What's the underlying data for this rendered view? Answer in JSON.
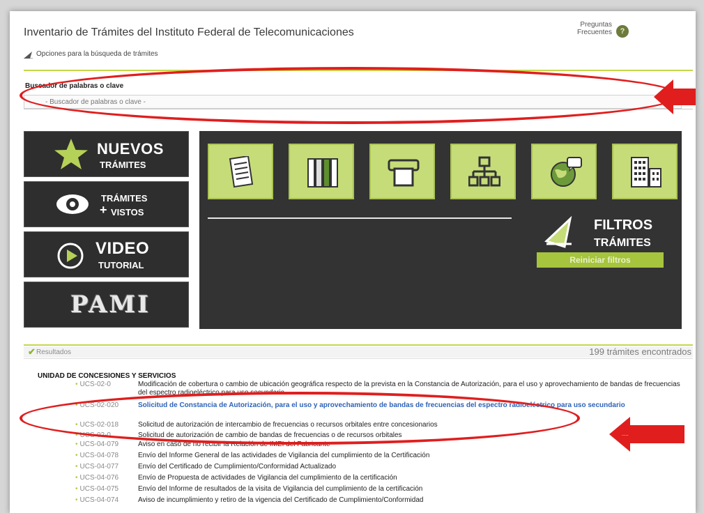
{
  "header": {
    "title": "Inventario de Trámites del Instituto Federal de Telecomunicaciones",
    "options_label": "Opciones para la búsqueda de trámites",
    "faq_line1": "Preguntas",
    "faq_line2": "Frecuentes",
    "faq_icon": "?"
  },
  "search": {
    "label": "Buscador de palabras o clave",
    "placeholder": "- Buscador de palabras o clave -"
  },
  "sidebar": {
    "nuevos": {
      "big": "NUEVOS",
      "small": "TRÁMITES"
    },
    "vistos": {
      "small1": "TRÁMITES",
      "small2": "VISTOS",
      "plus": "+"
    },
    "video": {
      "big": "VIDEO",
      "small": "TUTORIAL"
    },
    "pami": {
      "label": "PAMI"
    }
  },
  "filters": {
    "title_big": "FILTROS",
    "title_small": "TRÁMITES",
    "reset_label": "Reiniciar filtros",
    "category_icons": [
      "document-icon",
      "binders-icon",
      "printer-icon",
      "org-chart-icon",
      "globe-chat-icon",
      "buildings-icon"
    ]
  },
  "results": {
    "label": "Resultados",
    "count": "199 trámites encontrados",
    "unit": "UNIDAD DE CONCESIONES Y SERVICIOS",
    "rows": [
      {
        "code": "UCS-02-0",
        "desc": "Modificación de cobertura o cambio de ubicación geográfica respecto de la prevista en la Constancia de Autorización, para el uso y aprovechamiento de bandas de frecuencias del espectro radioeléctrico para uso secundario"
      },
      {
        "code": "UCS-02-020",
        "desc": "Solicitud de Constancia de Autorización, para el uso y aprovechamiento de bandas de frecuencias del espectro radioeléctrico para uso secundario"
      },
      {
        "code": "UCS-02-018",
        "desc": "Solicitud de autorización de intercambio de frecuencias o recursos orbitales entre concesionarios"
      },
      {
        "code": "UCS-02-0",
        "desc": "Solicitud de autorización de cambio de bandas de frecuencias o de recursos orbitales"
      },
      {
        "code": "UCS-04-079",
        "desc": "Aviso en caso de no recibir la Relación de IMEI del Fabricante"
      },
      {
        "code": "UCS-04-078",
        "desc": "Envío del Informe General de las actividades de Vigilancia del cumplimiento de la Certificación"
      },
      {
        "code": "UCS-04-077",
        "desc": "Envío del Certificado de Cumplimiento/Conformidad Actualizado"
      },
      {
        "code": "UCS-04-076",
        "desc": "Envío de Propuesta de actividades de Vigilancia del cumplimiento de la certificación"
      },
      {
        "code": "UCS-04-075",
        "desc": "Envío del Informe de resultados de la visita de Vigilancia del cumplimiento de la certificación"
      },
      {
        "code": "UCS-04-074",
        "desc": "Aviso de incumplimiento y retiro de la vigencia del Certificado de Cumplimiento/Conformidad"
      }
    ]
  },
  "colors": {
    "accent_green": "#c6dc78",
    "dark_panel": "#333333",
    "annotation_red": "#e01e1e",
    "link_blue": "#2f63b8"
  },
  "annotations": {
    "arrow_text": "....."
  }
}
